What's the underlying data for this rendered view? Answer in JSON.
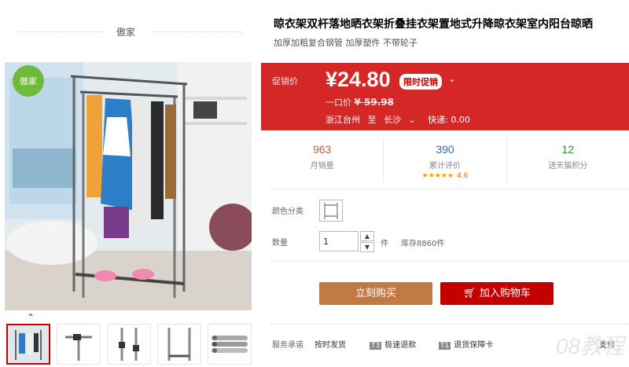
{
  "shop": {
    "name": "傲家"
  },
  "gallery": {
    "brand_badge": "傲家",
    "thumbs": [
      "thumb-1",
      "thumb-2",
      "thumb-3",
      "thumb-4",
      "thumb-5"
    ]
  },
  "product": {
    "title": "晾衣架双杆落地晒衣架折叠挂衣架置地式升降晾衣架室内阳台晾晒",
    "subtitle": "加厚加粗复合钢管 加厚塑件 不带轮子"
  },
  "promo": {
    "label": "促销价",
    "price": "¥24.80",
    "tag": "限时促销",
    "orig_label": "一口价",
    "orig_price": "¥ 59.98",
    "ship_from": "浙江台州",
    "ship_to_label": "至",
    "ship_to": "长沙",
    "shipping": "快递: 0.00"
  },
  "stats": [
    {
      "num": "963",
      "label": "月销量",
      "color": "#b8623f"
    },
    {
      "num": "390",
      "label": "累计评价",
      "color": "#3a6ea5",
      "stars": "★★★★★",
      "score": "4.6"
    },
    {
      "num": "12",
      "label": "送天猫积分",
      "color": "#2e8b3a"
    }
  ],
  "options": {
    "color_label": "颜色分类",
    "qty_label": "数量",
    "qty_value": "1",
    "unit": "件",
    "stock": "库存8860件"
  },
  "buttons": {
    "buy": "立刻购买",
    "cart": "加入购物车"
  },
  "service": {
    "label": "服务承诺",
    "items": [
      {
        "badge": "",
        "text": "按时发货"
      },
      {
        "badge": "T3",
        "text": "极速退款"
      },
      {
        "badge": "T1",
        "text": "退货保障卡"
      },
      {
        "badge": "",
        "text": "支付"
      }
    ]
  },
  "watermark": "08教程",
  "colors": {
    "promo_bg": "#d62727",
    "buy_btn": "#c27a45",
    "cart_btn": "#c40000",
    "accent": "#c40000"
  }
}
